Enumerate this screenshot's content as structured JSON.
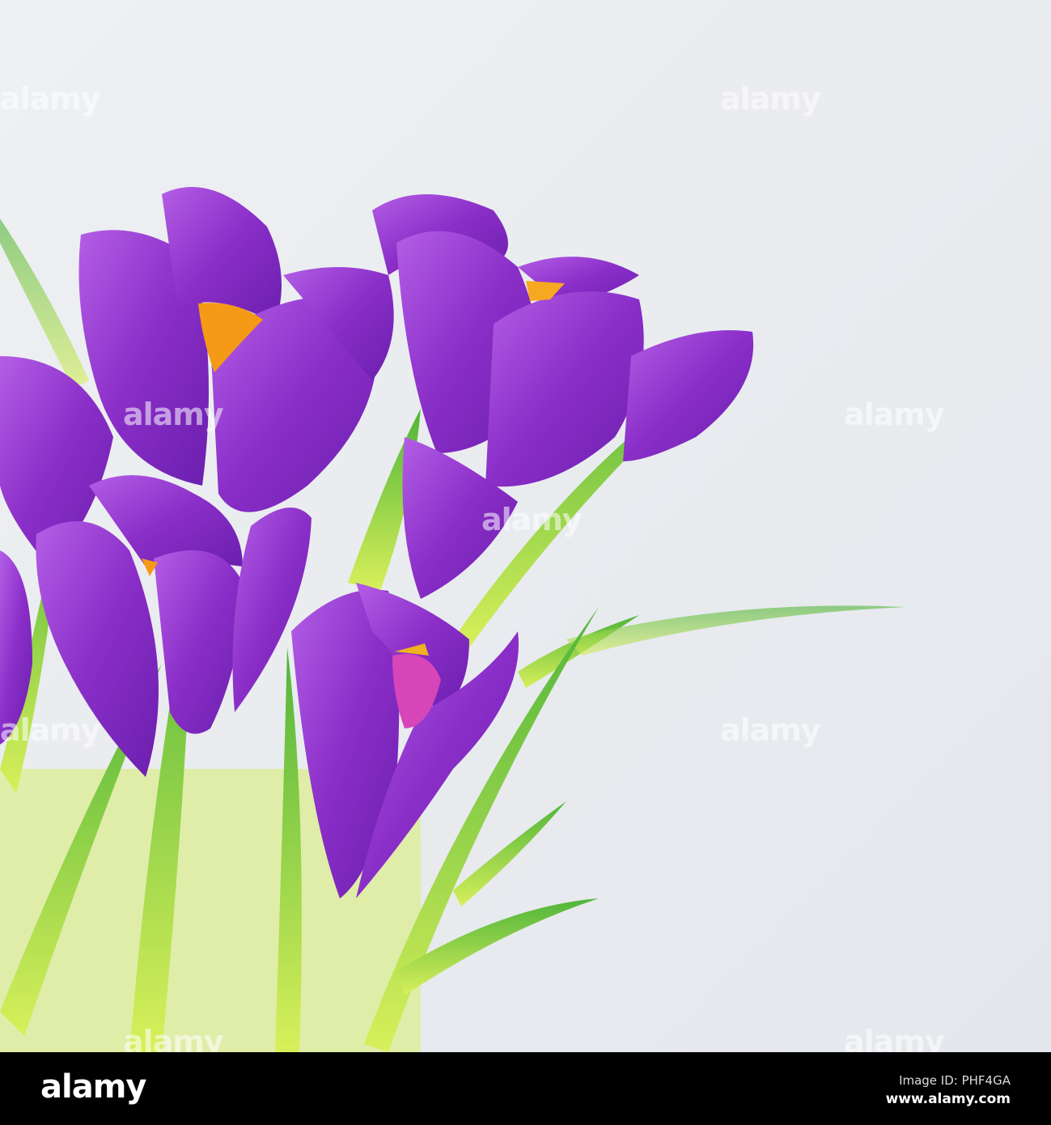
{
  "photo": {
    "subject": "purple crocus flowers",
    "colors": {
      "background": "#e9ebee",
      "petal": "#8a2fc9",
      "petal_light": "#b35ae0",
      "stamen": "#f7a21b",
      "leaf": "#7fd23a"
    }
  },
  "watermark": "alamy",
  "footer": {
    "logo": "alamy",
    "image_id": "Image ID: PHF4GA",
    "url": "www.alamy.com"
  }
}
